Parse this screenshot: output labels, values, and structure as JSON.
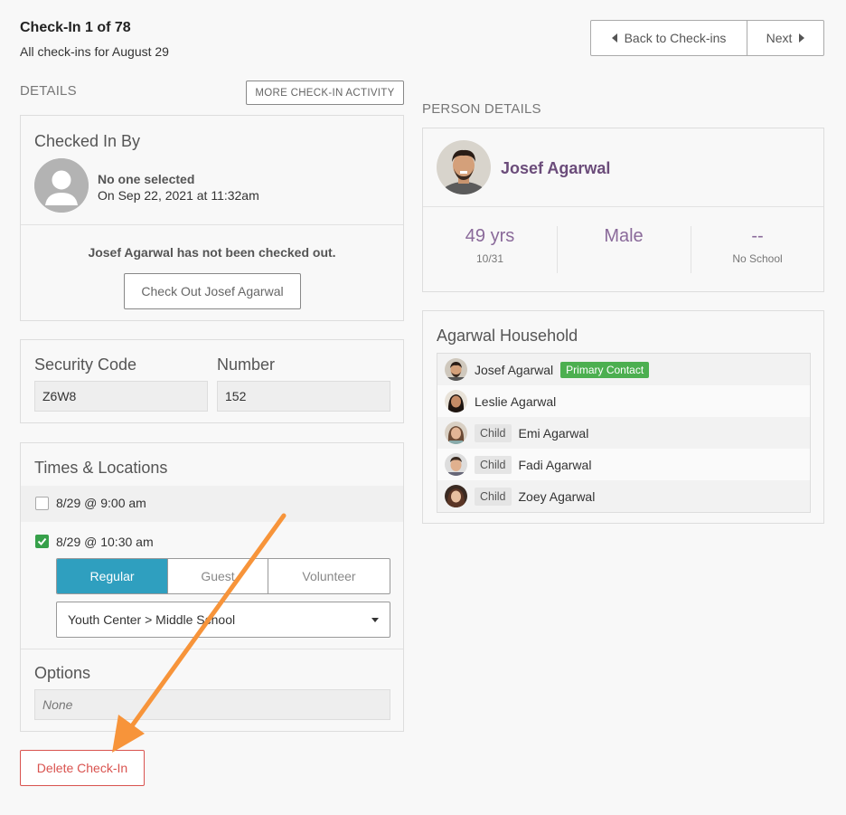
{
  "header": {
    "title": "Check-In 1 of 78",
    "subtitle": "All check-ins for August 29",
    "back_label": "Back to Check-ins",
    "next_label": "Next"
  },
  "details": {
    "section_label": "DETAILS",
    "more_activity_label": "MORE CHECK-IN ACTIVITY",
    "checked_in_by": {
      "heading": "Checked In By",
      "name": "No one selected",
      "timestamp": "On Sep 22, 2021 at 11:32am",
      "not_checked_out_msg": "Josef Agarwal has not been checked out.",
      "check_out_label": "Check Out Josef Agarwal"
    },
    "security": {
      "code_label": "Security Code",
      "code_value": "Z6W8",
      "number_label": "Number",
      "number_value": "152"
    },
    "times": {
      "heading": "Times & Locations",
      "items": [
        {
          "label": "8/29 @ 9:00 am",
          "checked": false
        },
        {
          "label": "8/29 @ 10:30 am",
          "checked": true
        }
      ],
      "kinds": [
        "Regular",
        "Guest",
        "Volunteer"
      ],
      "selected_kind": "Regular",
      "location": "Youth Center > Middle School"
    },
    "options": {
      "heading": "Options",
      "placeholder": "None"
    },
    "delete_label": "Delete Check-In"
  },
  "person": {
    "section_label": "PERSON DETAILS",
    "name": "Josef Agarwal",
    "age": "49 yrs",
    "birthday": "10/31",
    "gender": "Male",
    "school": "--",
    "school_label": "No School"
  },
  "household": {
    "heading": "Agarwal Household",
    "members": [
      {
        "name": "Josef Agarwal",
        "tag": "",
        "primary": "Primary Contact"
      },
      {
        "name": "Leslie Agarwal",
        "tag": "",
        "primary": ""
      },
      {
        "name": "Emi Agarwal",
        "tag": "Child",
        "primary": ""
      },
      {
        "name": "Fadi Agarwal",
        "tag": "Child",
        "primary": ""
      },
      {
        "name": "Zoey Agarwal",
        "tag": "Child",
        "primary": ""
      }
    ]
  },
  "colors": {
    "accent": "#2f9fbf",
    "person_name": "#6b4c7a",
    "danger": "#d9534f",
    "success": "#4caf50",
    "annotation_arrow": "#f7943a"
  }
}
